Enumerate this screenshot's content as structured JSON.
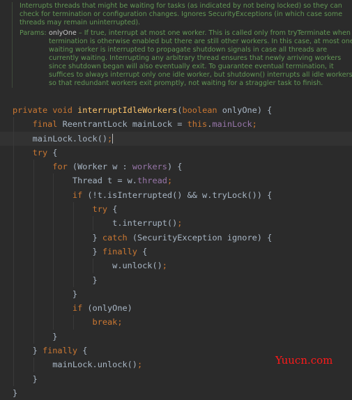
{
  "doc": {
    "summary": "Interrupts threads that might be waiting for tasks (as indicated by not being locked) so they can check for termination or configuration changes. Ignores SecurityExceptions (in which case some threads may remain uninterrupted).",
    "params_label": "Params:",
    "param_name": "onlyOne",
    "param_desc": " – If true, interrupt at most one worker. This is called only from tryTerminate when termination is otherwise enabled but there are still other workers. In this case, at most one waiting worker is interrupted to propagate shutdown signals in case all threads are currently waiting. Interrupting any arbitrary thread ensures that newly arriving workers since shutdown began will also eventually exit. To guarantee eventual termination, it suffices to always interrupt only one idle worker, but shutdown() interrupts all idle workers so that redundant workers exit promptly, not waiting for a straggler task to finish."
  },
  "colors": {
    "background": "#2b2b2b",
    "keyword": "#cc7832",
    "method": "#ffc66d",
    "field": "#9876aa",
    "text": "#a9b7c6",
    "doc": "#629755",
    "watermark": "#ff1a1a"
  },
  "cursor_line": 2,
  "code": [
    [
      [
        "kw",
        "private void "
      ],
      [
        "fn",
        "interruptIdleWorkers"
      ],
      [
        "tx",
        "("
      ],
      [
        "kw",
        "boolean "
      ],
      [
        "tx",
        "onlyOne) {"
      ]
    ],
    [
      [
        "tx",
        "    "
      ],
      [
        "kw",
        "final "
      ],
      [
        "tx",
        "ReentrantLock mainLock = "
      ],
      [
        "kw",
        "this"
      ],
      [
        "tx",
        "."
      ],
      [
        "fd",
        "mainLock"
      ],
      [
        "kw",
        ";"
      ]
    ],
    [
      [
        "tx",
        "    mainLock.lock()"
      ],
      [
        "kw",
        ";"
      ]
    ],
    [
      [
        "tx",
        "    "
      ],
      [
        "kw",
        "try "
      ],
      [
        "tx",
        "{"
      ]
    ],
    [
      [
        "tx",
        "        "
      ],
      [
        "kw",
        "for "
      ],
      [
        "tx",
        "(Worker w : "
      ],
      [
        "fd",
        "workers"
      ],
      [
        "tx",
        ") {"
      ]
    ],
    [
      [
        "tx",
        "            Thread t = w."
      ],
      [
        "fd",
        "thread"
      ],
      [
        "kw",
        ";"
      ]
    ],
    [
      [
        "tx",
        "            "
      ],
      [
        "kw",
        "if "
      ],
      [
        "tx",
        "(!t.isInterrupted() && w.tryLock()) {"
      ]
    ],
    [
      [
        "tx",
        "                "
      ],
      [
        "kw",
        "try "
      ],
      [
        "tx",
        "{"
      ]
    ],
    [
      [
        "tx",
        "                    t.interrupt()"
      ],
      [
        "kw",
        ";"
      ]
    ],
    [
      [
        "tx",
        "                } "
      ],
      [
        "kw",
        "catch "
      ],
      [
        "tx",
        "(SecurityException ignore) {"
      ]
    ],
    [
      [
        "tx",
        "                } "
      ],
      [
        "kw",
        "finally "
      ],
      [
        "tx",
        "{"
      ]
    ],
    [
      [
        "tx",
        "                    w.unlock()"
      ],
      [
        "kw",
        ";"
      ]
    ],
    [
      [
        "tx",
        "                }"
      ]
    ],
    [
      [
        "tx",
        "            }"
      ]
    ],
    [
      [
        "tx",
        "            "
      ],
      [
        "kw",
        "if "
      ],
      [
        "tx",
        "(onlyOne)"
      ]
    ],
    [
      [
        "tx",
        "                "
      ],
      [
        "kw",
        "break;"
      ]
    ],
    [
      [
        "tx",
        "        }"
      ]
    ],
    [
      [
        "tx",
        "    } "
      ],
      [
        "kw",
        "finally "
      ],
      [
        "tx",
        "{"
      ]
    ],
    [
      [
        "tx",
        "        mainLock.unlock()"
      ],
      [
        "kw",
        ";"
      ]
    ],
    [
      [
        "tx",
        "    }"
      ]
    ],
    [
      [
        "tx",
        "}"
      ]
    ]
  ],
  "watermark": "Yuucn.com"
}
